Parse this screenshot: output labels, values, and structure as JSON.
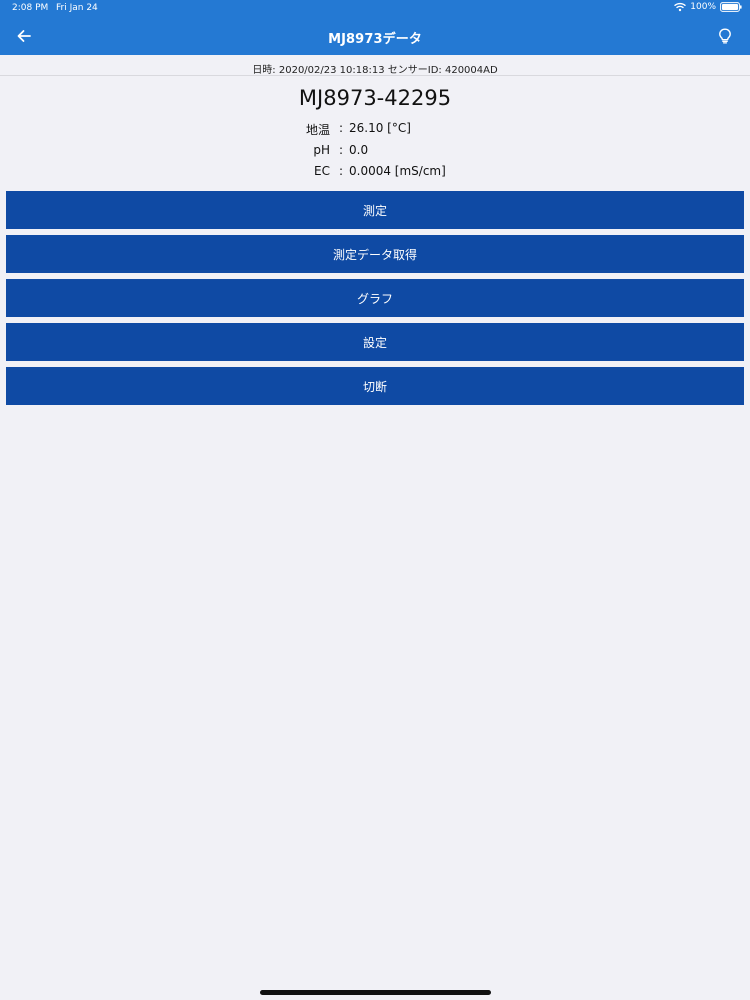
{
  "status_bar": {
    "time": "2:08 PM",
    "date": "Fri Jan 24",
    "battery": "100%",
    "icons": [
      "wifi-icon",
      "battery-icon"
    ]
  },
  "nav": {
    "title": "MJ8973データ",
    "back_icon": "arrow-left-icon",
    "light_icon": "lightbulb-icon"
  },
  "info": {
    "meta": "日時: 2020/02/23 10:18:13 センサーID: 420004AD",
    "device_name": "MJ8973-42295"
  },
  "readings": [
    {
      "label": "地温",
      "colon": ":",
      "value": "26.10 [°C]"
    },
    {
      "label": "pH",
      "colon": ":",
      "value": "0.0"
    },
    {
      "label": "EC",
      "colon": ":",
      "value": "0.0004 [mS/cm]"
    }
  ],
  "actions": [
    {
      "label": "測定"
    },
    {
      "label": "測定データ取得"
    },
    {
      "label": "グラフ"
    },
    {
      "label": "設定"
    },
    {
      "label": "切断"
    }
  ],
  "colors": {
    "header": "#2479d3",
    "button": "#0f4aa4",
    "background": "#f1f1f6"
  }
}
